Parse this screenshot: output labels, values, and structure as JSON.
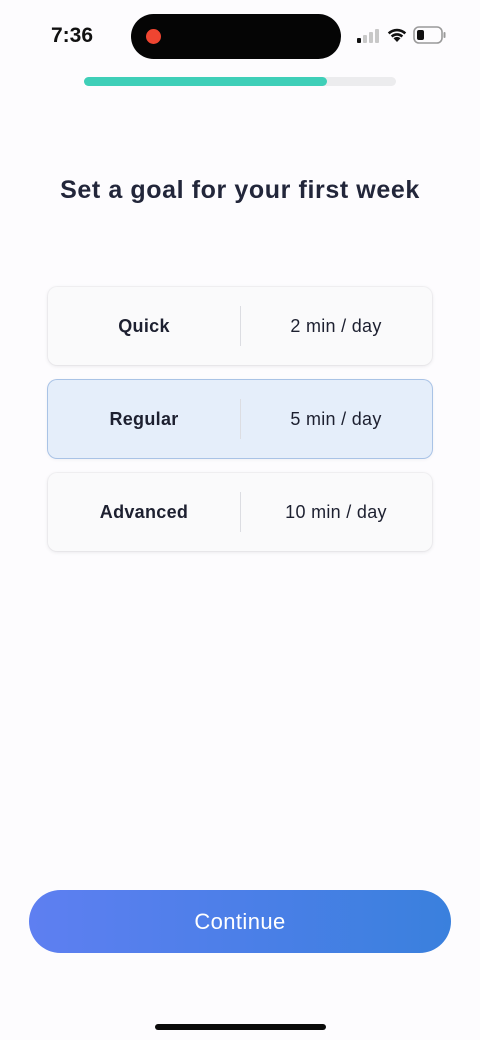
{
  "status_bar": {
    "time": "7:36",
    "icons": [
      "signal-icon",
      "wifi-icon",
      "battery-icon"
    ],
    "recording_dot_color": "#ef4531"
  },
  "progress": {
    "fraction": 0.78,
    "color": "#3fcfb8"
  },
  "title": "Set a goal for your first week",
  "options": [
    {
      "name": "Quick",
      "time": "2 min / day",
      "selected": false
    },
    {
      "name": "Regular",
      "time": "5 min / day",
      "selected": true
    },
    {
      "name": "Advanced",
      "time": "10 min / day",
      "selected": false
    }
  ],
  "continue_label": "Continue",
  "colors": {
    "selected_bg": "#e5eefa",
    "button_gradient_start": "#5e7ff1",
    "button_gradient_end": "#3a80dd"
  }
}
